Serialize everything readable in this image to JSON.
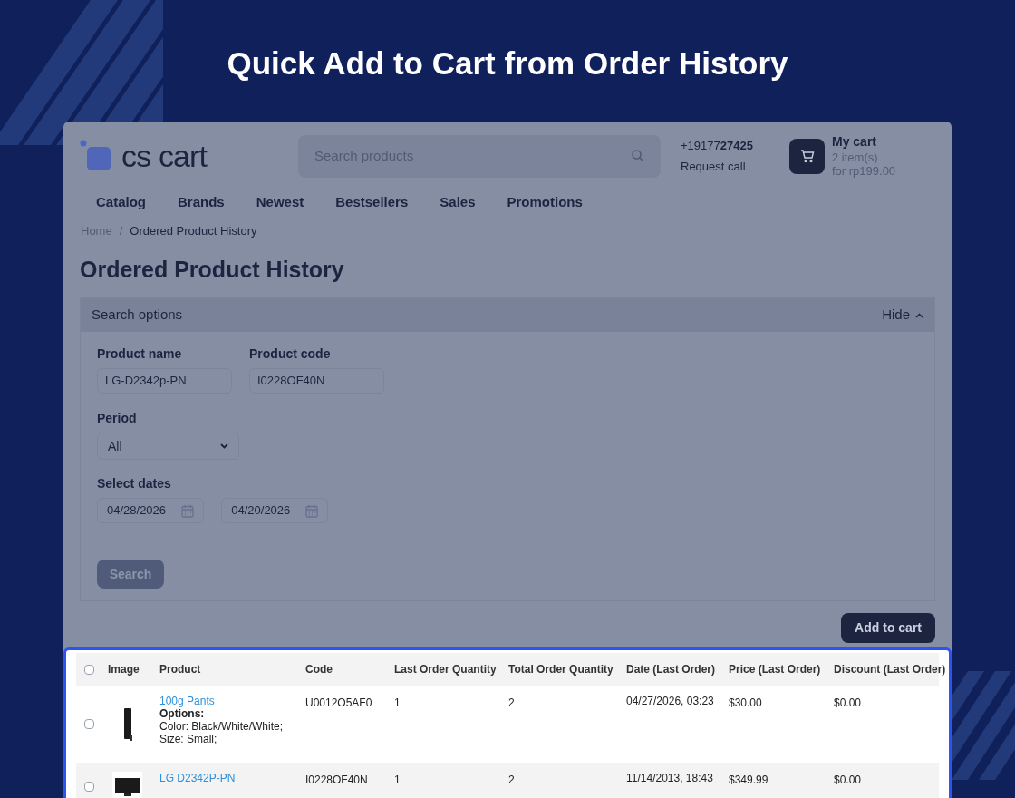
{
  "headline": "Quick Add to Cart from Order History",
  "store": {
    "logo": "cs cart",
    "search": {
      "placeholder": "Search products"
    },
    "phone": "+19177**27425**",
    "request_call": "Request call",
    "cart": {
      "title": "My cart",
      "items": "2 item(s)",
      "total": "for rp199.00"
    }
  },
  "nav": [
    "Catalog",
    "Brands",
    "Newest",
    "Bestsellers",
    "Sales",
    "Promotions"
  ],
  "breadcrumb": {
    "items": [
      "Home",
      "Ordered Product History"
    ],
    "separator": "/"
  },
  "page_title": "Ordered Product History",
  "search_options": {
    "title": "Search options",
    "toggle": "Hide",
    "expanded": true,
    "fields": [
      {
        "label": "Product name",
        "value": "LG-D2342p-PN"
      },
      {
        "label": "Product code",
        "value": "I0228OF40N"
      }
    ],
    "period": {
      "label": "Period",
      "value": "All"
    },
    "dates": {
      "label": "Select dates",
      "from": "04/28/2026",
      "separator": "–",
      "to": "04/20/2026"
    },
    "search_button": "Search"
  },
  "add_to_cart": "Add to cart",
  "table": {
    "select_all_checked": false,
    "columns": [
      "Image",
      "Product",
      "Code",
      "Last Order Quantity",
      "Total Order Quantity",
      "Date (Last Order)",
      "Price (Last Order)",
      "Discount (Last Order)"
    ],
    "rows": [
      {
        "checked": false,
        "kind": "tower",
        "product": "100g Pants",
        "options_label": "Options:",
        "options": [
          "Color: Black/White/White;",
          "Size: Small;"
        ],
        "code": "U0012O5AF0",
        "last_qty": "1",
        "total_qty": "2",
        "date": "04/27/2026, 03:23",
        "price": "$30.00",
        "discount": "$0.00"
      },
      {
        "checked": false,
        "kind": "monitor",
        "product": "LG D2342P-PN",
        "code": "I0228OF40N",
        "last_qty": "1",
        "total_qty": "2",
        "date": "11/14/2013, 18:43",
        "price": "$349.99",
        "discount": "$0.00"
      }
    ]
  }
}
